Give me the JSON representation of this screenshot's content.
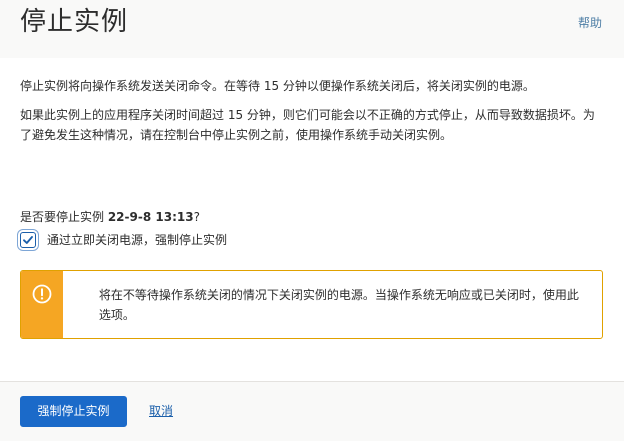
{
  "dialog": {
    "title": "停止实例",
    "help_label": "帮助"
  },
  "body": {
    "paragraph1": "停止实例将向操作系统发送关闭命令。在等待 15 分钟以便操作系统关闭后，将关闭实例的电源。",
    "paragraph2": "如果此实例上的应用程序关闭时间超过 15 分钟，则它们可能会以不正确的方式停止，从而导致数据损坏。为了避免发生这种情况，请在控制台中停止实例之前，使用操作系统手动关闭实例。",
    "question_prefix": "是否要停止实例 ",
    "instance_name": "22-9-8 13:13",
    "question_suffix": "?"
  },
  "force_option": {
    "label": "通过立即关闭电源，强制停止实例",
    "checked": true
  },
  "warning": {
    "icon": "warning-icon",
    "text": "将在不等待操作系统关闭的情况下关闭实例的电源。当操作系统无响应或已关闭时，使用此选项。",
    "accent_color": "#f5a623"
  },
  "footer": {
    "primary_label": "强制停止实例",
    "cancel_label": "取消"
  },
  "colors": {
    "primary": "#1b6ac9",
    "link": "#1b5faa",
    "warning": "#f5a623",
    "header_bg": "#f9f9f8"
  }
}
